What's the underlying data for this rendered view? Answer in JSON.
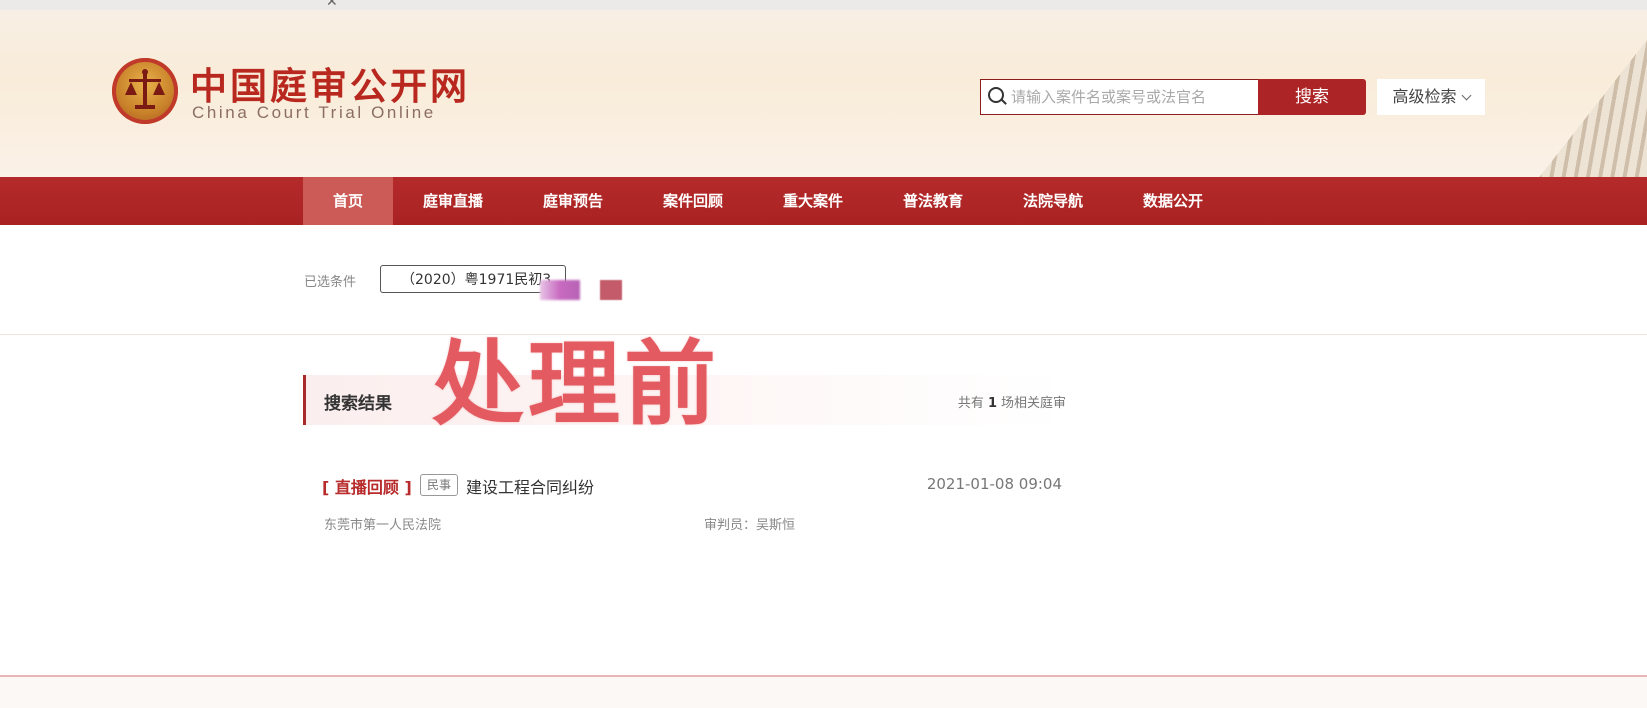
{
  "header": {
    "site_title": "中国庭审公开网",
    "site_subtitle": "China Court Trial Online",
    "search": {
      "placeholder": "请输入案件名或案号或法官名",
      "value": ""
    },
    "search_button": "搜索",
    "advanced_search": "高级检索"
  },
  "nav": {
    "items": [
      {
        "label": "首页",
        "active": true
      },
      {
        "label": "庭审直播"
      },
      {
        "label": "庭审预告"
      },
      {
        "label": "案件回顾"
      },
      {
        "label": "重大案件"
      },
      {
        "label": "普法教育"
      },
      {
        "label": "法院导航"
      },
      {
        "label": "数据公开"
      }
    ]
  },
  "filter": {
    "label": "已选条件",
    "tag": "（2020）粤1971民初3"
  },
  "watermark": "处理前",
  "results": {
    "title": "搜索结果",
    "count_prefix": "共有",
    "count": "1",
    "count_suffix": "场相关庭审",
    "items": [
      {
        "tag": "[ 直播回顾 ]",
        "type": "民事",
        "title": "建设工程合同纠纷",
        "date": "2021-01-08 09:04",
        "court": "东莞市第一人民法院",
        "judge": "审判员：吴斯恒"
      }
    ]
  },
  "colors": {
    "brand_red": "#a92222",
    "active_nav": "#cc5a56",
    "watermark": "#e35a61"
  }
}
